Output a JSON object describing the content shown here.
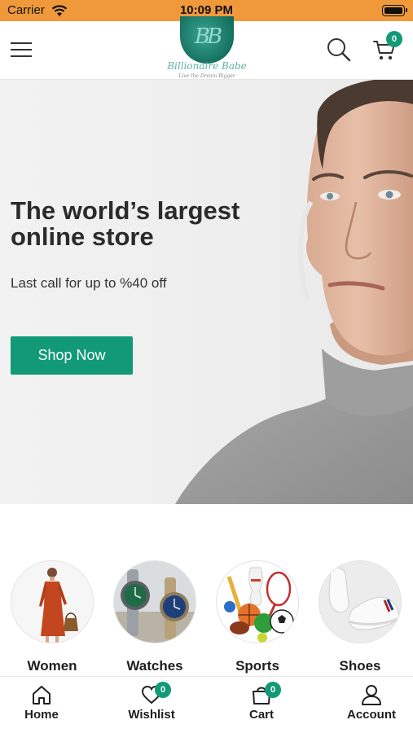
{
  "status_bar": {
    "carrier": "Carrier",
    "time": "10:09 PM"
  },
  "header": {
    "logo_text": "Billionaire Babe",
    "logo_monogram": "BB",
    "logo_tagline": "Live the Dream Bigger",
    "cart_count": "0"
  },
  "hero": {
    "title": "The world’s largest online store",
    "subtitle": "Last call for up to %40 off",
    "cta_label": "Shop Now"
  },
  "categories": [
    {
      "label": "Women"
    },
    {
      "label": "Watches"
    },
    {
      "label": "Sports"
    },
    {
      "label": "Shoes"
    }
  ],
  "bottom_nav": {
    "home": {
      "label": "Home"
    },
    "wishlist": {
      "label": "Wishlist",
      "badge": "0"
    },
    "cart": {
      "label": "Cart",
      "badge": "0"
    },
    "account": {
      "label": "Account"
    }
  },
  "colors": {
    "accent": "#129a78",
    "status_bar": "#f0993b"
  },
  "icons": [
    "menu-icon",
    "search-icon",
    "cart-icon",
    "wifi-icon",
    "battery-icon",
    "home-icon",
    "heart-icon",
    "bag-icon",
    "user-icon"
  ]
}
